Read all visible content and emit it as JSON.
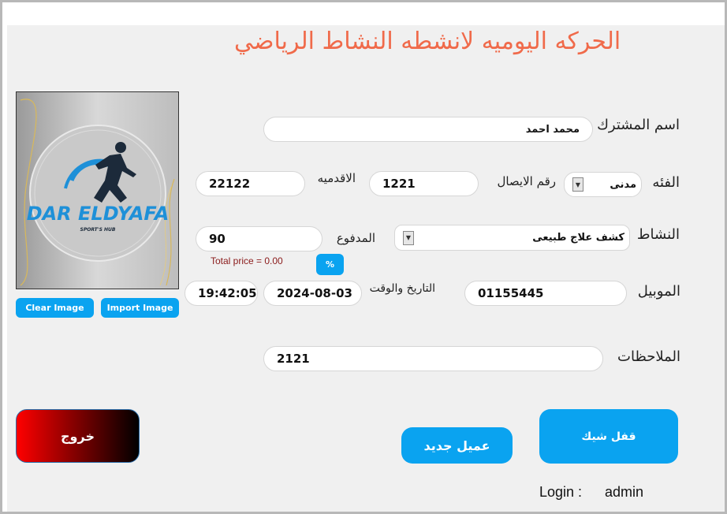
{
  "header": {
    "title": "الحركه اليوميه لانشطه النشاط الرياضي"
  },
  "form": {
    "subscriber": {
      "label": "اسم المشترك",
      "value": "محمد احمد"
    },
    "category": {
      "label": "الفئه",
      "selected": "مدنى"
    },
    "receipt": {
      "label": "رقم الايصال",
      "value": "1221"
    },
    "seniority": {
      "label": "الاقدميه",
      "value": "22122"
    },
    "activity": {
      "label": "النشاط",
      "selected": "كشف علاج طبيعى"
    },
    "paid": {
      "label": "المدفوع",
      "value": "90"
    },
    "total_price": "Total price = 0.00",
    "percent_button": "%",
    "mobile": {
      "label": "الموبيل",
      "value": "01155445"
    },
    "datetime": {
      "label": "التاريخ والوقت",
      "date": "2024-08-03",
      "time": "19:42:05"
    },
    "notes": {
      "label": "الملاحظات",
      "value": "2121"
    }
  },
  "image_panel": {
    "logo_text": "DAR ELDYAFA",
    "logo_subtext": "SPORT'S HUB",
    "clear_label": "Clear Image",
    "import_label": "Import Image"
  },
  "actions": {
    "exit_label": "خروج",
    "new_client_label": "عميل جديد",
    "lock_check_label": "قفل شيك"
  },
  "status": {
    "login_label": "Login :",
    "login_user": "admin"
  },
  "colors": {
    "accent": "#0aa3f0",
    "title": "#f06a4a",
    "exit_start": "#ff0000",
    "exit_end": "#000000"
  }
}
